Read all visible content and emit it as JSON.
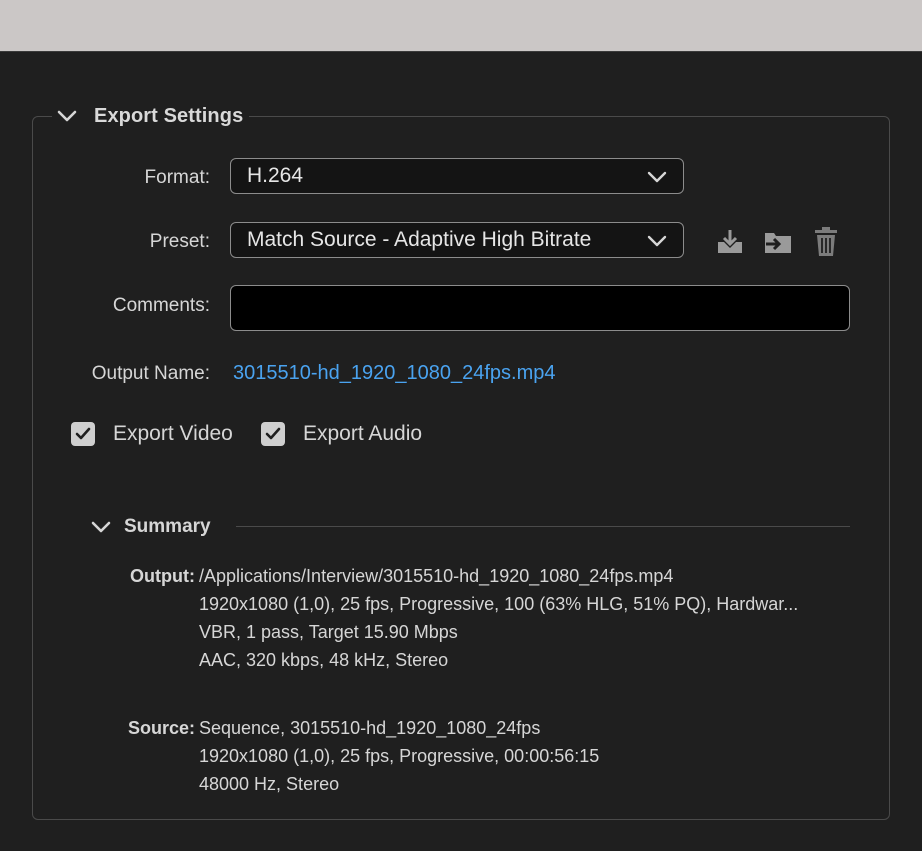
{
  "export_settings": {
    "title": "Export Settings",
    "format_label": "Format:",
    "format_value": "H.264",
    "preset_label": "Preset:",
    "preset_value": "Match Source - Adaptive High Bitrate",
    "comments_label": "Comments:",
    "comments_value": "",
    "output_name_label": "Output Name:",
    "output_name_value": "3015510-hd_1920_1080_24fps.mp4",
    "export_video_label": "Export Video",
    "export_video_checked": true,
    "export_audio_label": "Export Audio",
    "export_audio_checked": true,
    "preset_icons": [
      "save-preset-icon",
      "import-preset-icon",
      "delete-preset-icon"
    ]
  },
  "summary": {
    "title": "Summary",
    "output_key": "Output:",
    "output_lines": [
      "/Applications/Interview/3015510-hd_1920_1080_24fps.mp4",
      "1920x1080 (1,0), 25 fps, Progressive, 100 (63% HLG, 51% PQ), Hardwar...",
      "VBR, 1 pass, Target 15.90 Mbps",
      "AAC, 320 kbps, 48 kHz, Stereo"
    ],
    "source_key": "Source:",
    "source_lines": [
      "Sequence, 3015510-hd_1920_1080_24fps",
      "1920x1080 (1,0), 25 fps, Progressive, 00:00:56:15",
      "48000 Hz, Stereo"
    ]
  },
  "colors": {
    "background": "#1f1f1f",
    "top_bar": "#cbc7c6",
    "link": "#4aa3f0",
    "checkbox": "#cfcfcf"
  }
}
